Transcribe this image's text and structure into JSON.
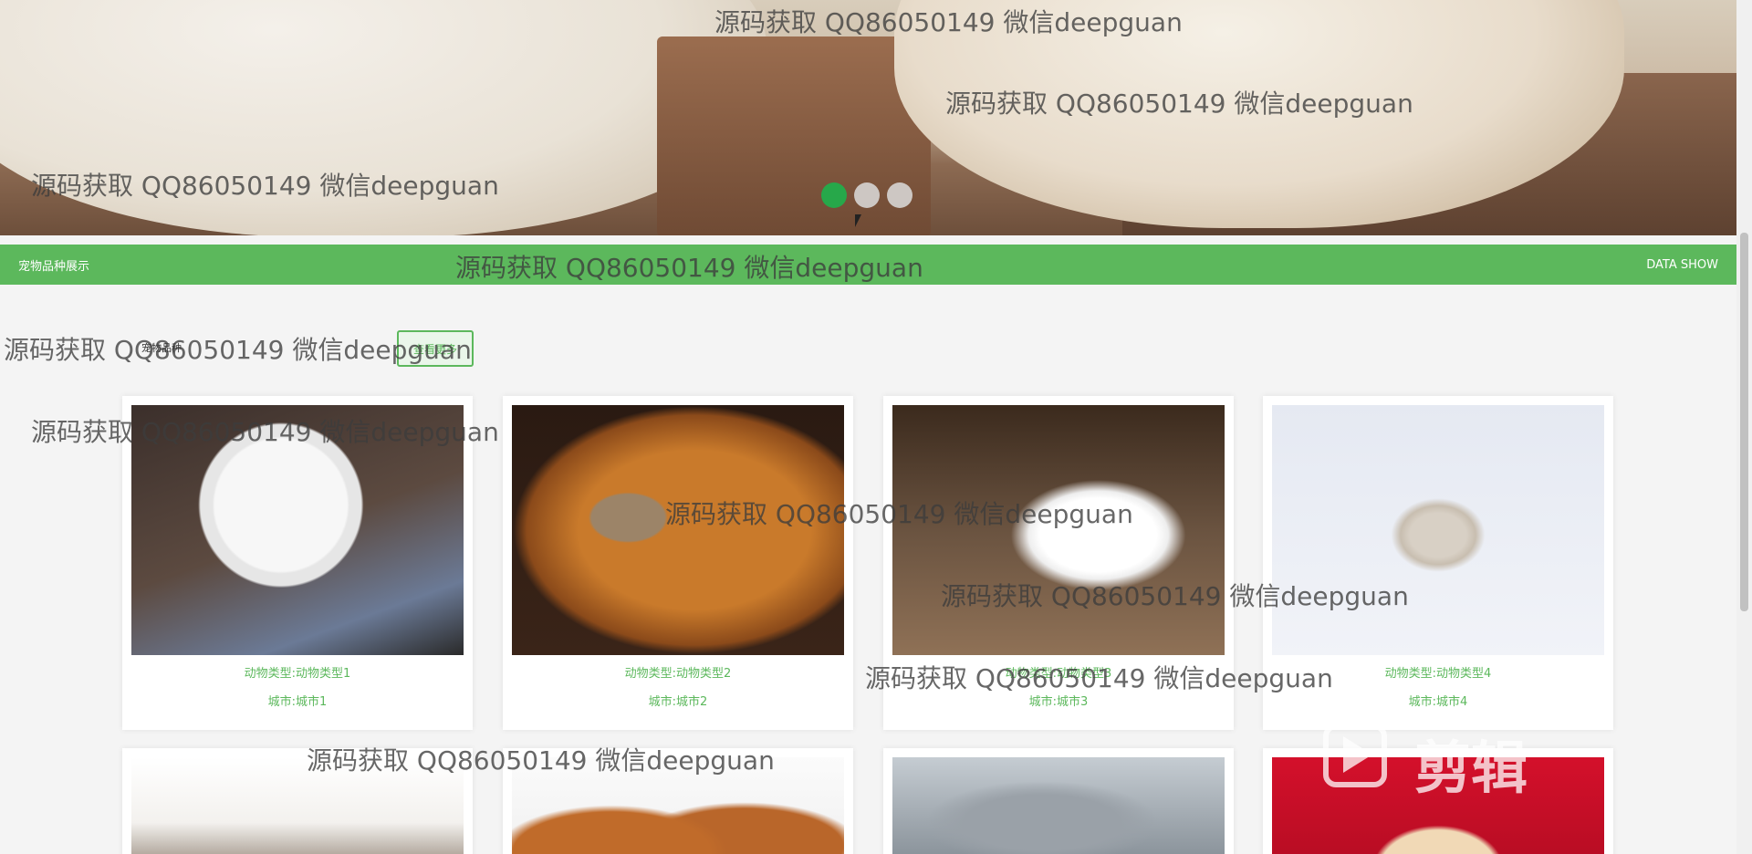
{
  "banner": {
    "slides": [
      "slide-1",
      "slide-2",
      "slide-3"
    ],
    "active_slide": 1
  },
  "navbar": {
    "left_label": "宠物品种展示",
    "right_label": "DATA SHOW"
  },
  "section": {
    "title": "宠物品种",
    "more_label": "查看更多"
  },
  "cards": [
    {
      "line1": "动物类型:动物类型1",
      "line2": "城市:城市1"
    },
    {
      "line1": "动物类型:动物类型2",
      "line2": "城市:城市2"
    },
    {
      "line1": "动物类型:动物类型3",
      "line2": "城市:城市3"
    },
    {
      "line1": "动物类型:动物类型4",
      "line2": "城市:城市4"
    }
  ],
  "watermark": "源码获取 QQ86050149 微信deepguan",
  "overlay_logo": "剪辑",
  "colors": {
    "accent_green": "#5cb85c",
    "active_dot": "#27a84a"
  }
}
